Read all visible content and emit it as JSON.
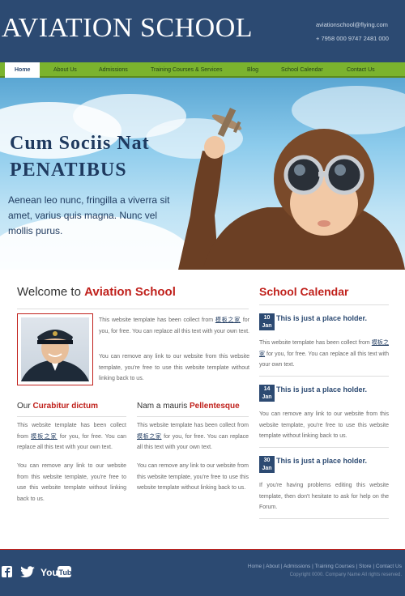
{
  "header": {
    "logo": "AVIATION SCHOOL",
    "email": "aviationschool@flying.com",
    "phone": "+ 7958 000 9747 2481 000"
  },
  "nav": {
    "items": [
      "Home",
      "About Us",
      "Admissions",
      "Training Courses & Services",
      "Blog",
      "School Calendar",
      "Contact Us"
    ],
    "active": "Home"
  },
  "hero": {
    "title_line1": "Cum Sociis Nat",
    "title_line2": "PENATIBUS",
    "text": "Aenean leo nunc, fringilla a viverra sit amet, varius quis magna. Nunc vel mollis purus."
  },
  "welcome": {
    "title_prefix": "Welcome to ",
    "title_highlight": "Aviation School",
    "para1_before": "This website template has been collect from ",
    "para1_link": "模板之家",
    "para1_after": " for you, for free. You can replace all this text with your own text.",
    "para2": "You can remove any link to our website from this website template, you're free to use this website template without linking back to us."
  },
  "col1": {
    "title_prefix": "Our ",
    "title_highlight": "Curabitur dictum",
    "para1_before": "This website template has been collect from ",
    "para1_link": "模板之家",
    "para1_after": " for you, for free. You can replace all this text with your own text.",
    "para2": "You can remove any link to our website from this website template, you're free to use this website template without linking back to us."
  },
  "col2": {
    "title_prefix": "Nam a mauris ",
    "title_highlight": "Pellentesque",
    "para1_before": "This website template has been collect from ",
    "para1_link": "模板之家",
    "para1_after": " for you, for free. You can replace all this text with your own text.",
    "para2": "You can remove any link to our website from this website template, you're free to use this website template without linking back to us."
  },
  "calendar": {
    "title": "School Calendar",
    "events": [
      {
        "day": "10",
        "month": "Jan",
        "title": "This is just a place holder.",
        "text_before": "This website template has been collect from ",
        "text_link": "模板之家",
        "text_after": " for you, for free. You can replace all this text with your own text."
      },
      {
        "day": "14",
        "month": "Jan",
        "title": "This is just a place holder.",
        "text": "You can remove any link to our website from this website template, you're free to use this website template without linking back to us."
      },
      {
        "day": "30",
        "month": "Jan",
        "title": "This is just a place holder.",
        "text": "If you're having problems editing this website template, then don't hesitate to ask for help on the Forum."
      }
    ]
  },
  "footer": {
    "links": "Home | About | Admissions | Training Courses | Store | Contact Us",
    "copyright": "Copyright 0000. Company Name All rights reserved.",
    "social": [
      "facebook-icon",
      "twitter-icon",
      "youtube-icon"
    ]
  },
  "colors": {
    "navy": "#2c4a72",
    "green": "#7bb32e",
    "red": "#c0211c"
  }
}
